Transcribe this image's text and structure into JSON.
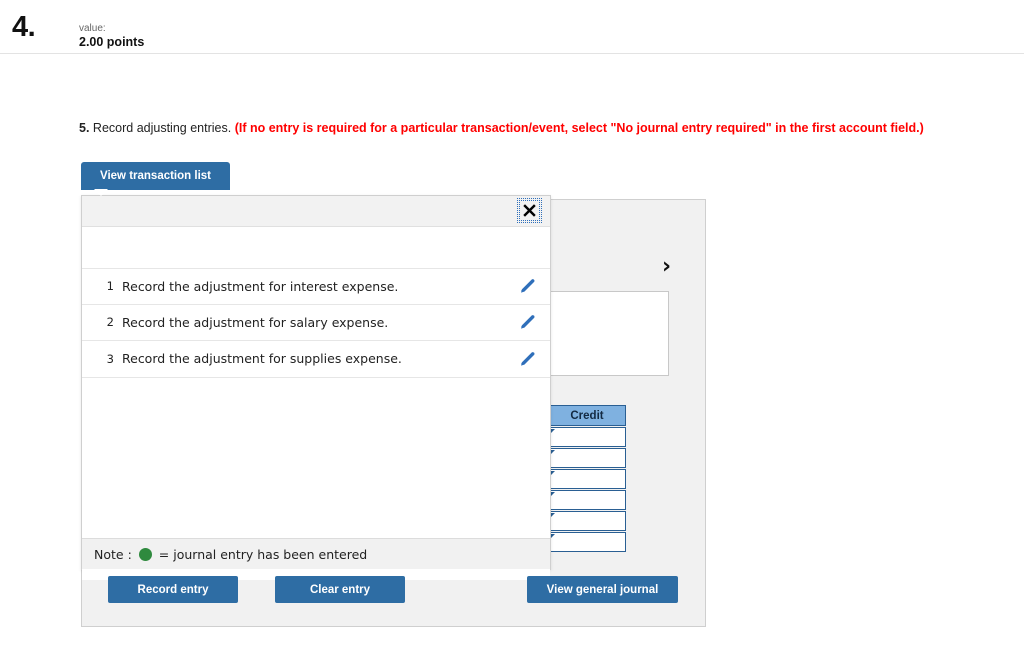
{
  "question": {
    "number": "4.",
    "value_label": "value:",
    "points": "2.00 points"
  },
  "instruction": {
    "number": "5.",
    "text": "Record adjusting entries.",
    "note": "(If no entry is required for a particular transaction/event, select \"No journal entry required\" in the first account field.)",
    "note_color": "#ff0000"
  },
  "tab": {
    "label": "View transaction list"
  },
  "dialog": {
    "close_icon": "close-x-icon",
    "transactions": [
      {
        "index": "1",
        "description": "Record the adjustment for interest expense.",
        "edit_icon": "pencil-icon"
      },
      {
        "index": "2",
        "description": "Record the adjustment for salary expense.",
        "edit_icon": "pencil-icon"
      },
      {
        "index": "3",
        "description": "Record the adjustment for supplies expense.",
        "edit_icon": "pencil-icon"
      }
    ],
    "note_prefix": "Note :",
    "note_suffix": "= journal entry has been entered",
    "note_dot_color": "#2f8a3e"
  },
  "worksheet": {
    "chevron_icon": "chevron-right-icon",
    "credit_header": "Credit",
    "credit_rows": [
      "",
      "",
      "",
      "",
      "",
      ""
    ]
  },
  "actions": {
    "record_entry": "Record entry",
    "clear_entry": "Clear entry",
    "view_general_journal": "View general journal",
    "button_color": "#2e6da4"
  }
}
